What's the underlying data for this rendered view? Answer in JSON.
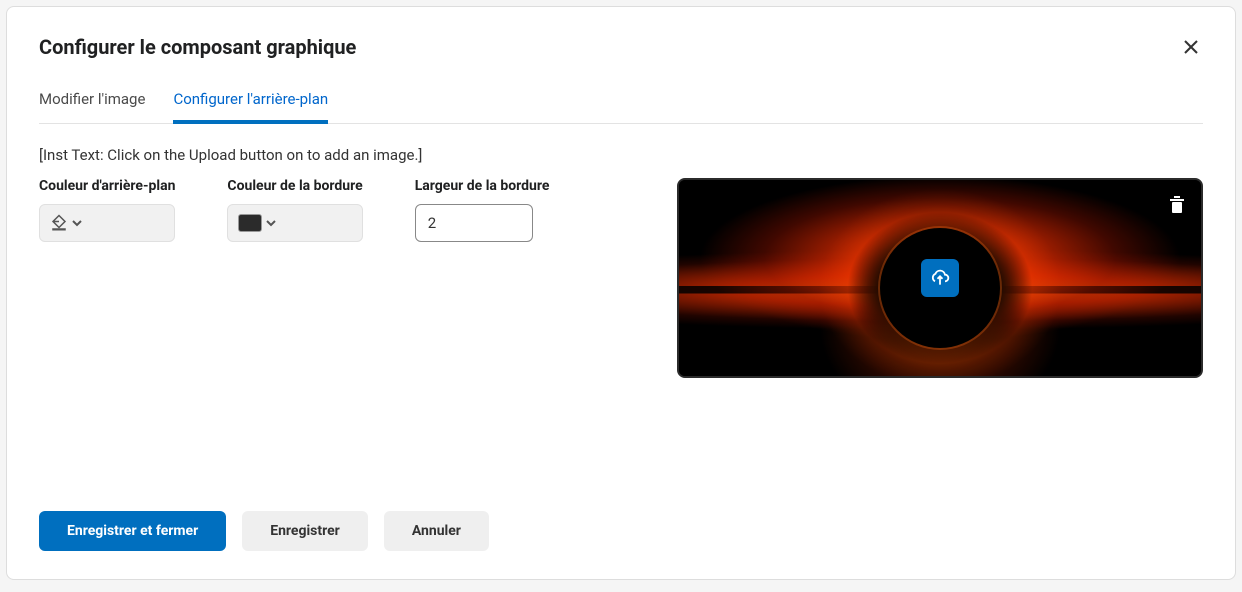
{
  "modal": {
    "title": "Configurer le composant graphique"
  },
  "tabs": {
    "edit_image": "Modifier l'image",
    "configure_bg": "Configurer l'arrière-plan"
  },
  "instruction": "[Inst Text: Click on the Upload button on to add an image.]",
  "fields": {
    "bg_color_label": "Couleur d'arrière-plan",
    "border_color_label": "Couleur de la bordure",
    "border_width_label": "Largeur de la bordure",
    "border_width_value": "2"
  },
  "footer": {
    "save_close": "Enregistrer et fermer",
    "save": "Enregistrer",
    "cancel": "Annuler"
  }
}
